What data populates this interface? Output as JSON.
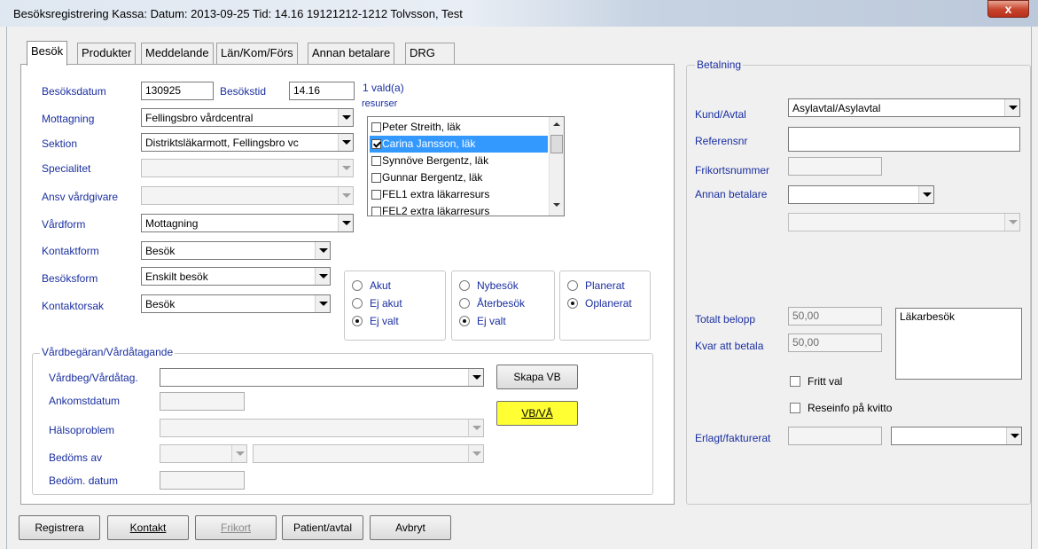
{
  "window": {
    "title": "Besöksregistrering  Kassa:   Datum: 2013-09-25  Tid: 14.16  19121212-1212 Tolvsson, Test",
    "close": "x"
  },
  "tabs": [
    {
      "label": "Besök"
    },
    {
      "label": "Produkter"
    },
    {
      "label": "Meddelande"
    },
    {
      "label": "Län/Kom/Förs"
    },
    {
      "label": "Annan betalare"
    },
    {
      "label": "DRG"
    }
  ],
  "form": {
    "besoksdatum_label": "Besöksdatum",
    "besoksdatum_value": "130925",
    "besokstid_label": "Besökstid",
    "besokstid_value": "14.16",
    "resurser_label": "1 vald(a)",
    "resurser_label2": "resurser",
    "mottagning_label": "Mottagning",
    "mottagning_value": "Fellingsbro vårdcentral",
    "sektion_label": "Sektion",
    "sektion_value": "Distriktsläkarmott, Fellingsbro vc",
    "specialitet_label": "Specialitet",
    "ansv_label": "Ansv vårdgivare",
    "vardform_label": "Vårdform",
    "vardform_value": "Mottagning",
    "kontaktform_label": "Kontaktform",
    "kontaktform_value": "Besök",
    "besoksform_label": "Besöksform",
    "besoksform_value": "Enskilt besök",
    "kontaktorsak_label": "Kontaktorsak",
    "kontaktorsak_value": "Besök"
  },
  "resources": [
    {
      "label": "Peter Streith, läk",
      "checked": false
    },
    {
      "label": "Carina Jansson, läk",
      "checked": true
    },
    {
      "label": "Synnöve Bergentz, läk",
      "checked": false
    },
    {
      "label": "Gunnar Bergentz, läk",
      "checked": false
    },
    {
      "label": "FEL1 extra läkarresurs",
      "checked": false
    },
    {
      "label": "FEL2 extra läkarresurs",
      "checked": false
    }
  ],
  "radio_groups": {
    "akut": [
      "Akut",
      "Ej akut",
      "Ej valt"
    ],
    "akut_selected": "Ej valt",
    "besok": [
      "Nybesök",
      "Återbesök",
      "Ej valt"
    ],
    "besok_selected": "Ej valt",
    "plan": [
      "Planerat",
      "Oplanerat"
    ],
    "plan_selected": "Oplanerat"
  },
  "vardbegaran": {
    "title": "Vårdbegäran/Vårdåtagande",
    "vardbeg_label": "Vårdbeg/Vårdåtag.",
    "ankomst_label": "Ankomstdatum",
    "halso_label": "Hälsoproblem",
    "bedoms_label": "Bedöms av",
    "bedom_datum_label": "Bedöm. datum",
    "skapa_vb": "Skapa VB",
    "vb_va": "VB/VÅ"
  },
  "betalning": {
    "title": "Betalning",
    "kund_label": "Kund/Avtal",
    "kund_value": "Asylavtal/Asylavtal",
    "referens_label": "Referensnr",
    "frikort_label": "Frikortsnummer",
    "annan_label": "Annan betalare",
    "totalt_label": "Totalt belopp",
    "totalt_value": "50,00",
    "kvar_label": "Kvar att betala",
    "kvar_value": "50,00",
    "note_text": "Läkarbesök",
    "fritt_val": "Fritt val",
    "reseinfo": "Reseinfo på kvitto",
    "erlagt_label": "Erlagt/fakturerat"
  },
  "buttons": {
    "registrera": "Registrera",
    "kontakt": "Kontakt",
    "frikort": "Frikort",
    "patient_avtal": "Patient/avtal",
    "avbryt": "Avbryt"
  }
}
